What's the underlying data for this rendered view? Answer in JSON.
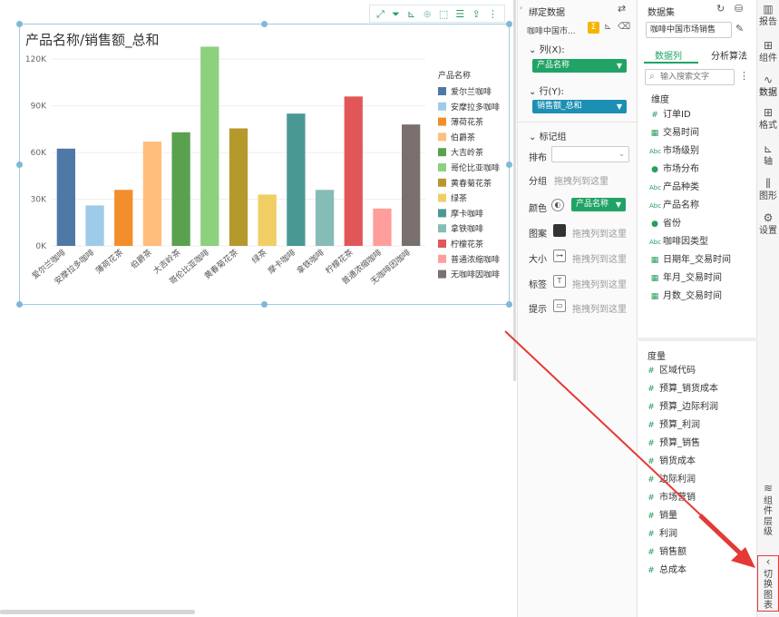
{
  "chart": {
    "title": "产品名称/销售额_总和",
    "toolbar_icons": [
      "expand-icon",
      "filter-icon",
      "drill-icon",
      "zoom-icon",
      "select-icon",
      "table-icon",
      "export-icon",
      "more-icon"
    ]
  },
  "chart_data": {
    "type": "bar",
    "title": "产品名称/销售额_总和",
    "xlabel": "",
    "ylabel": "",
    "ylim": [
      0,
      130000
    ],
    "yticks": [
      "0K",
      "30K",
      "60K",
      "90K",
      "120K"
    ],
    "ytick_values": [
      0,
      30000,
      60000,
      90000,
      120000
    ],
    "categories": [
      "爱尔兰咖啡",
      "安摩拉多咖啡",
      "薄荷花茶",
      "伯爵茶",
      "大吉岭茶",
      "哥伦比亚咖啡",
      "黄春菊花茶",
      "绿茶",
      "摩卡咖啡",
      "拿铁咖啡",
      "柠檬花茶",
      "普通浓缩咖啡",
      "无咖啡因咖啡"
    ],
    "values": [
      62500,
      26000,
      36000,
      67000,
      73000,
      128000,
      75500,
      33000,
      85000,
      36000,
      96000,
      24000,
      78000
    ],
    "colors": [
      "#4e79a7",
      "#a0cbe8",
      "#f28e2b",
      "#ffbe7d",
      "#59a14f",
      "#8cd17d",
      "#b6992d",
      "#f1ce63",
      "#499894",
      "#86bcb6",
      "#e15759",
      "#ff9d9a",
      "#79706e"
    ],
    "legend": {
      "title": "产品名称",
      "position": "right"
    }
  },
  "bind_panel": {
    "title": "绑定数据",
    "dataset_short": "咖啡中国市...",
    "columns_label": "列(X):",
    "columns_pill": "产品名称",
    "rows_label": "行(Y):",
    "rows_pill": "销售额_总和",
    "mark_group_label": "标记组",
    "layout_label": "排布",
    "group_label": "分组",
    "group_hint": "拖拽列到这里",
    "color_label": "颜色",
    "color_pill": "产品名称",
    "pattern_label": "图案",
    "size_label": "大小",
    "tag_label": "标签",
    "tip_label": "提示",
    "drop_hint": "拖拽列到这里"
  },
  "data_panel": {
    "title": "数据集",
    "dataset_name": "咖啡中国市场销售",
    "tab_columns": "数据列",
    "tab_algorithms": "分析算法",
    "search_placeholder": "输入搜索文字",
    "dimension_header": "维度",
    "dimensions": [
      {
        "icon": "#",
        "name": "订单ID"
      },
      {
        "icon": "cal",
        "name": "交易时间"
      },
      {
        "icon": "abc",
        "name": "市场级别"
      },
      {
        "icon": "geo",
        "name": "市场分布"
      },
      {
        "icon": "abc",
        "name": "产品种类"
      },
      {
        "icon": "abc",
        "name": "产品名称"
      },
      {
        "icon": "geo",
        "name": "省份"
      },
      {
        "icon": "abc",
        "name": "咖啡因类型"
      },
      {
        "icon": "cal",
        "name": "日期年_交易时间"
      },
      {
        "icon": "cal",
        "name": "年月_交易时间"
      },
      {
        "icon": "cal",
        "name": "月数_交易时间"
      }
    ],
    "measure_header": "度量",
    "measures": [
      "区域代码",
      "预算_销货成本",
      "预算_边际利润",
      "预算_利润",
      "预算_销售",
      "销货成本",
      "边际利润",
      "市场营销",
      "销量",
      "利润",
      "销售额",
      "总成本"
    ]
  },
  "right_rail": {
    "items": [
      {
        "icon": "report-icon",
        "label": "报告"
      },
      {
        "icon": "component-icon",
        "label": "组件"
      },
      {
        "icon": "data-icon",
        "label": "数据"
      },
      {
        "icon": "format-icon",
        "label": "格式"
      },
      {
        "icon": "axis-icon",
        "label": "轴"
      },
      {
        "icon": "graph-icon",
        "label": "图形"
      },
      {
        "icon": "settings-icon",
        "label": "设置"
      }
    ],
    "layers_label": "组件层级",
    "switch_label": "切换图表"
  },
  "annotation": {
    "arrow_color": "#e53935"
  }
}
